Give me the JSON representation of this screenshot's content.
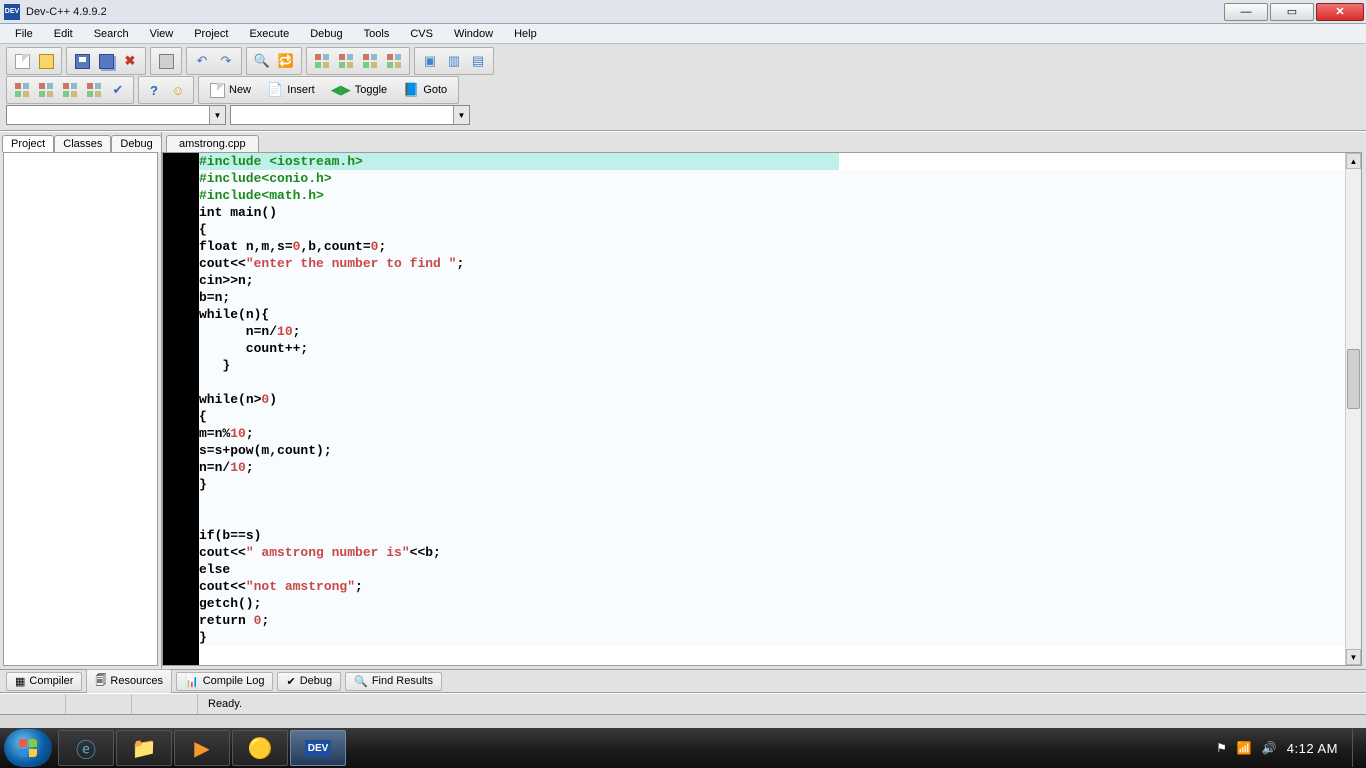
{
  "window": {
    "title": "Dev-C++ 4.9.9.2"
  },
  "menu": [
    "File",
    "Edit",
    "Search",
    "View",
    "Project",
    "Execute",
    "Debug",
    "Tools",
    "CVS",
    "Window",
    "Help"
  ],
  "toolbar": {
    "new": "New",
    "insert": "Insert",
    "toggle": "Toggle",
    "goto": "Goto"
  },
  "side_tabs": [
    "Project",
    "Classes",
    "Debug"
  ],
  "doc_tab": "amstrong.cpp",
  "code": [
    {
      "t": "#include <iostream.h>",
      "cls": "pp-green",
      "hl": 1
    },
    {
      "t": "#include<conio.h>",
      "cls": "pp-green"
    },
    {
      "t": "#include<math.h>",
      "cls": "pp-green"
    },
    {
      "tokens": [
        [
          "k",
          "int"
        ],
        [
          "",
          " main()"
        ]
      ]
    },
    {
      "t": "{"
    },
    {
      "tokens": [
        [
          "k",
          "float"
        ],
        [
          "",
          " n,m,s="
        ],
        [
          "num",
          "0"
        ],
        [
          "",
          ",b,count="
        ],
        [
          "num",
          "0"
        ],
        [
          "",
          ";"
        ]
      ]
    },
    {
      "tokens": [
        [
          "",
          "cout<<"
        ],
        [
          "str",
          "\"enter the number to find \""
        ],
        [
          "",
          ";"
        ]
      ]
    },
    {
      "t": "cin>>n;"
    },
    {
      "t": "b=n;"
    },
    {
      "tokens": [
        [
          "k",
          "while"
        ],
        [
          "",
          "(n){"
        ]
      ]
    },
    {
      "tokens": [
        [
          "",
          "      n=n/"
        ],
        [
          "num",
          "10"
        ],
        [
          "",
          ";"
        ]
      ]
    },
    {
      "t": "      count++;"
    },
    {
      "t": "   }"
    },
    {
      "t": ""
    },
    {
      "tokens": [
        [
          "k",
          "while"
        ],
        [
          "",
          "(n>"
        ],
        [
          "num",
          "0"
        ],
        [
          "",
          ")"
        ]
      ]
    },
    {
      "t": "{"
    },
    {
      "tokens": [
        [
          "",
          "m=n%"
        ],
        [
          "num",
          "10"
        ],
        [
          "",
          ";"
        ]
      ]
    },
    {
      "t": "s=s+pow(m,count);"
    },
    {
      "tokens": [
        [
          "",
          "n=n/"
        ],
        [
          "num",
          "10"
        ],
        [
          "",
          ";"
        ]
      ]
    },
    {
      "t": "}"
    },
    {
      "t": ""
    },
    {
      "t": ""
    },
    {
      "tokens": [
        [
          "k",
          "if"
        ],
        [
          "",
          "(b==s)"
        ]
      ]
    },
    {
      "tokens": [
        [
          "",
          "cout<<"
        ],
        [
          "str",
          "\" amstrong number is\""
        ],
        [
          "",
          "<<b;"
        ]
      ]
    },
    {
      "tokens": [
        [
          "k",
          "else"
        ]
      ]
    },
    {
      "tokens": [
        [
          "",
          "cout<<"
        ],
        [
          "str",
          "\"not amstrong\""
        ],
        [
          "",
          ";"
        ]
      ]
    },
    {
      "t": "getch();"
    },
    {
      "tokens": [
        [
          "k",
          "return"
        ],
        [
          "",
          " "
        ],
        [
          "num",
          "0"
        ],
        [
          "",
          ";"
        ]
      ]
    },
    {
      "t": "}"
    }
  ],
  "bottom_tabs": [
    "Compiler",
    "Resources",
    "Compile Log",
    "Debug",
    "Find Results"
  ],
  "status": "Ready.",
  "clock": "4:12 AM"
}
